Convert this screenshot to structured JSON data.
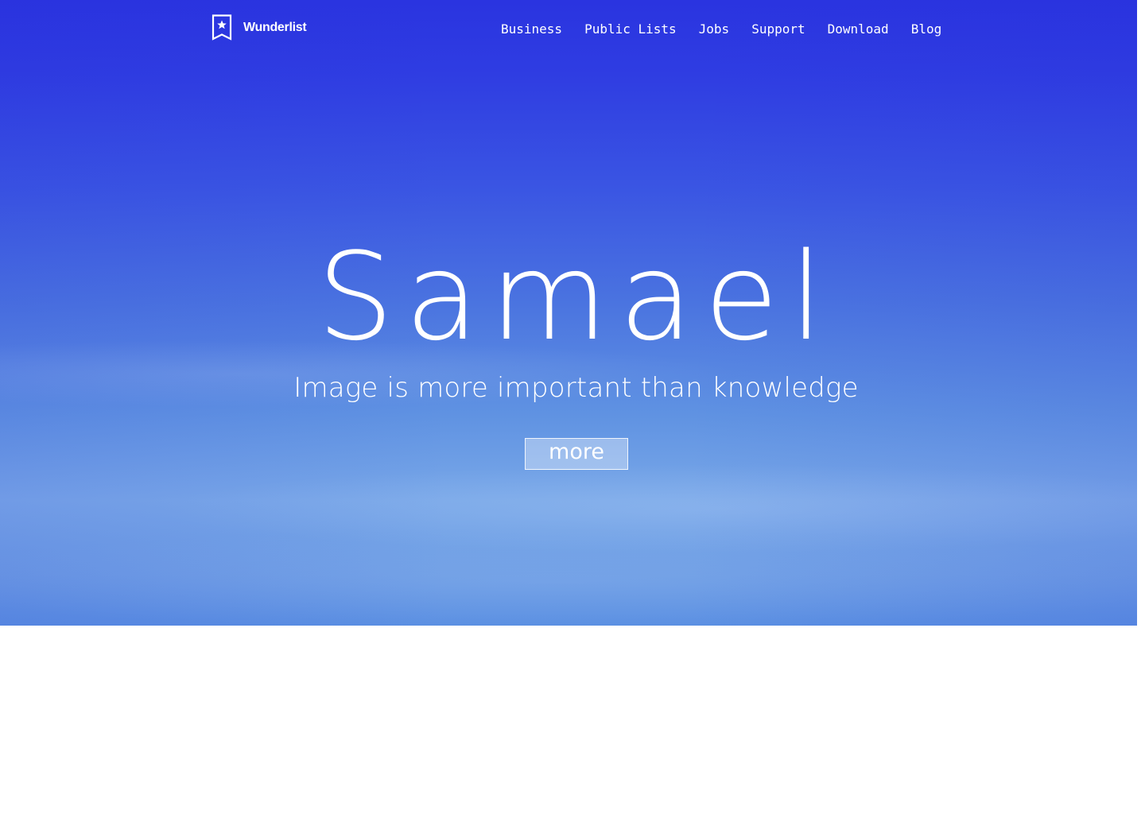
{
  "brand": {
    "name": "Wunderlist",
    "icon": "bookmark-star-icon"
  },
  "nav": {
    "items": [
      {
        "label": "Business"
      },
      {
        "label": "Public Lists"
      },
      {
        "label": "Jobs"
      },
      {
        "label": "Support"
      },
      {
        "label": "Download"
      },
      {
        "label": "Blog"
      }
    ]
  },
  "hero": {
    "title": "Samael",
    "subtitle": "Image is more important than knowledge",
    "button_label": "more"
  },
  "colors": {
    "sky_top": "#2a34e0",
    "sky_mid": "#4a73e0",
    "sky_bottom": "#79a8e8",
    "text": "#ffffff",
    "page_background": "#ffffff"
  }
}
